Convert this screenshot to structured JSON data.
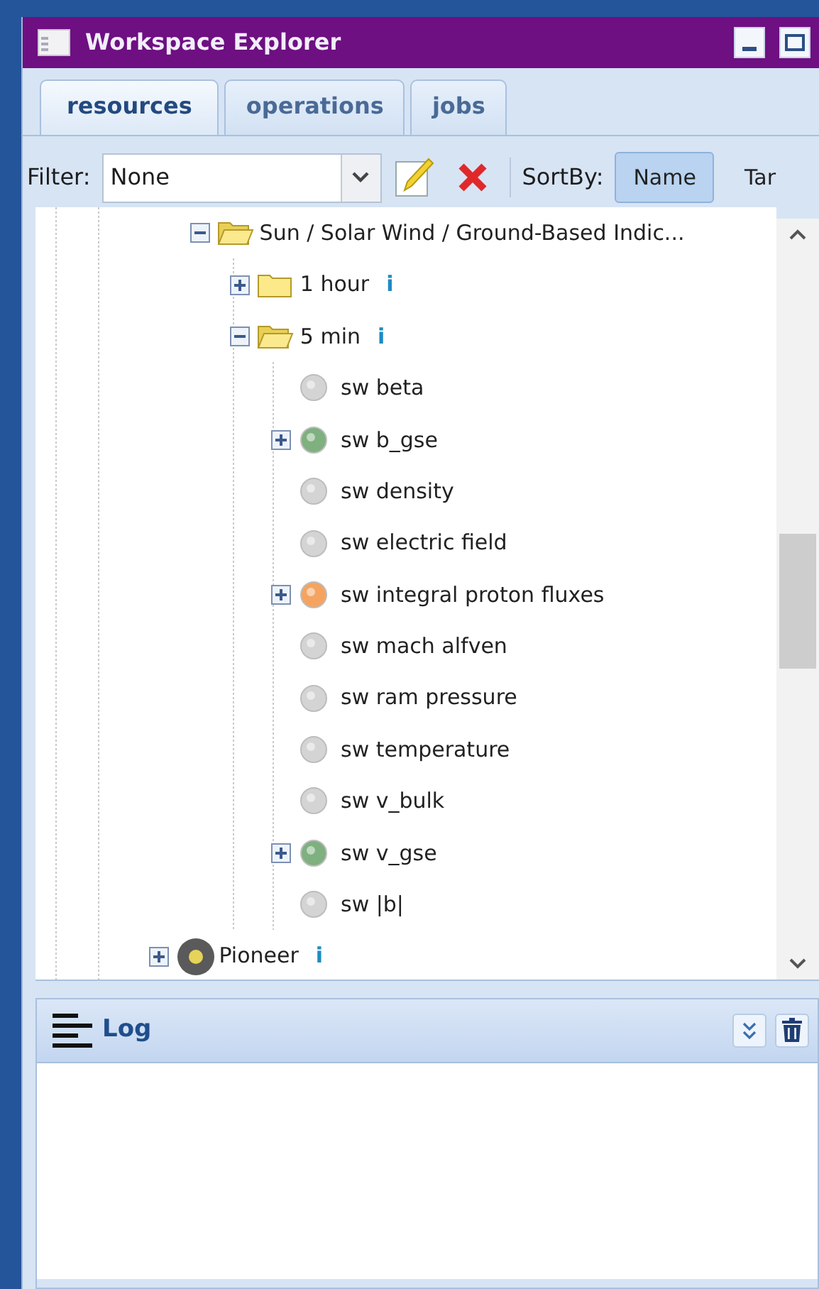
{
  "window": {
    "title": "Workspace Explorer"
  },
  "tabs": [
    {
      "label": "resources",
      "selected": true
    },
    {
      "label": "operations",
      "selected": false
    },
    {
      "label": "jobs",
      "selected": false
    }
  ],
  "toolbar": {
    "filter_label": "Filter:",
    "filter_value": "None",
    "sort_label": "SortBy:",
    "sort_options": [
      {
        "label": "Name",
        "selected": true
      },
      {
        "label": "Tar",
        "selected": false
      }
    ]
  },
  "tree": [
    {
      "children": [
        {
          "label": "Sun / Solar Wind / Ground-Based Indic...",
          "kind": "folder",
          "expanded": true,
          "children": [
            {
              "label": "1 hour",
              "kind": "folder",
              "expanded": false,
              "info": "i"
            },
            {
              "label": "5 min",
              "kind": "folder",
              "expanded": true,
              "info": "i",
              "children": [
                {
                  "label": "sw beta",
                  "kind": "parameter",
                  "color": "#d4d4d4"
                },
                {
                  "label": "sw b_gse",
                  "kind": "parameter",
                  "color": "#7fb07f",
                  "expanded": false
                },
                {
                  "label": "sw density",
                  "kind": "parameter",
                  "color": "#d4d4d4"
                },
                {
                  "label": "sw electric field",
                  "kind": "parameter",
                  "color": "#d4d4d4"
                },
                {
                  "label": "sw integral proton fluxes",
                  "kind": "parameter",
                  "color": "#f5a360",
                  "expanded": false
                },
                {
                  "label": "sw mach alfven",
                  "kind": "parameter",
                  "color": "#d4d4d4"
                },
                {
                  "label": "sw ram pressure",
                  "kind": "parameter",
                  "color": "#d4d4d4"
                },
                {
                  "label": "sw temperature",
                  "kind": "parameter",
                  "color": "#d4d4d4"
                },
                {
                  "label": "sw v_bulk",
                  "kind": "parameter",
                  "color": "#d4d4d4"
                },
                {
                  "label": "sw v_gse",
                  "kind": "parameter",
                  "color": "#7fb07f",
                  "expanded": false
                },
                {
                  "label": "sw |b|",
                  "kind": "parameter",
                  "color": "#d4d4d4"
                }
              ]
            }
          ]
        }
      ]
    },
    {
      "label": "Pioneer",
      "kind": "mission",
      "expanded": false,
      "info": "i"
    }
  ],
  "log": {
    "title": "Log"
  }
}
